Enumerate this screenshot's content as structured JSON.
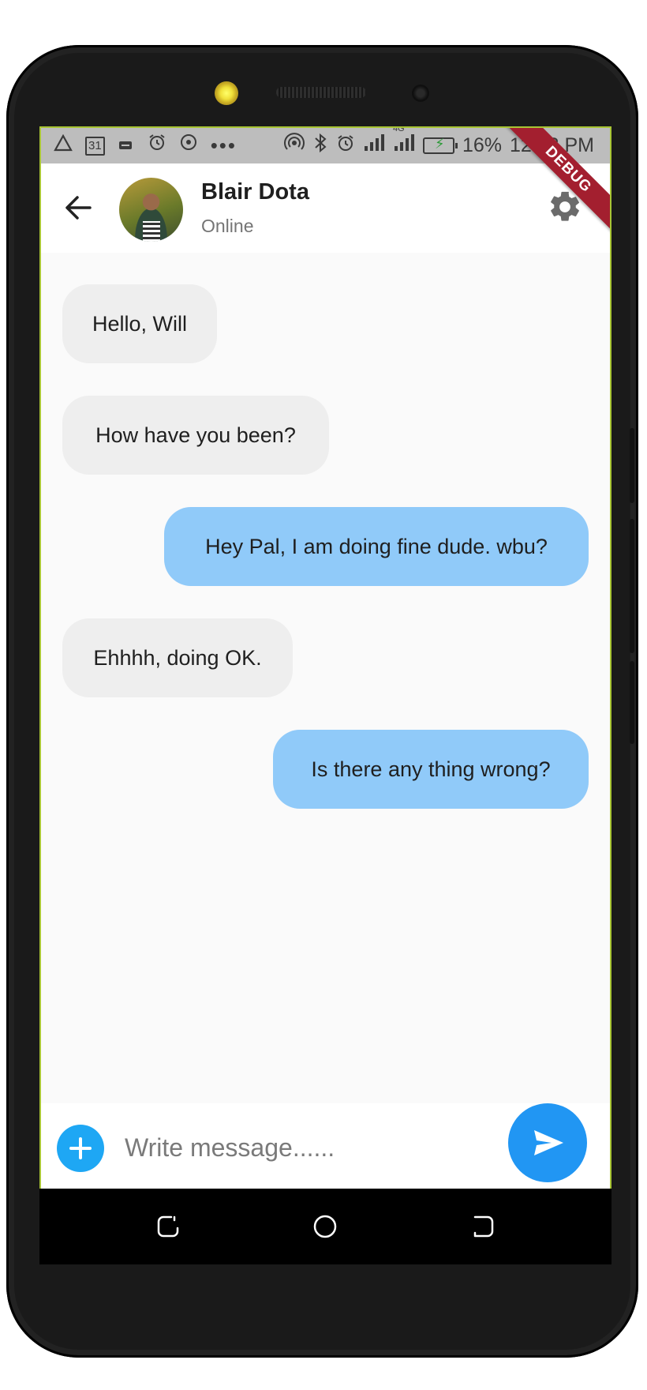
{
  "status_bar": {
    "battery_percent": "16%",
    "time": "12:53 PM",
    "network": "4G",
    "debug_banner": "DEBUG",
    "left_icons": [
      "warning-triangle-icon",
      "calendar-31-icon",
      "message-icon",
      "alarm-icon",
      "target-icon",
      "more-dots-icon"
    ],
    "calendar_day": "31"
  },
  "header": {
    "contact_name": "Blair Dota",
    "contact_status": "Online",
    "back_icon": "arrow-back-icon",
    "settings_icon": "gear-icon"
  },
  "messages": [
    {
      "text": "Hello, Will",
      "direction": "incoming"
    },
    {
      "text": "How have you been?",
      "direction": "incoming"
    },
    {
      "text": "Hey Pal, I am doing fine dude. wbu?",
      "direction": "outgoing"
    },
    {
      "text": "Ehhhh, doing OK.",
      "direction": "incoming"
    },
    {
      "text": "Is there any thing wrong?",
      "direction": "outgoing"
    }
  ],
  "composer": {
    "placeholder": "Write message......",
    "value": "",
    "add_icon": "plus-icon",
    "send_icon": "send-icon"
  },
  "colors": {
    "incoming_bubble": "#eeeeee",
    "outgoing_bubble": "#90caf9",
    "send_button": "#2196f3",
    "add_button": "#1ea7f4",
    "debug_ribbon": "#a31f2f"
  },
  "nav_bar": [
    "recents-icon",
    "home-icon",
    "back-icon"
  ]
}
